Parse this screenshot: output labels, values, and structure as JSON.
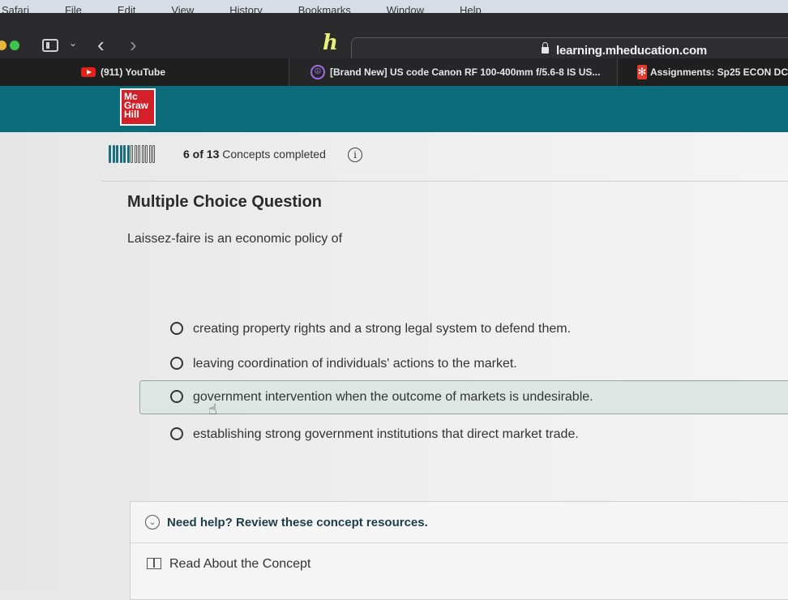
{
  "menubar": {
    "items": [
      "Safari",
      "File",
      "Edit",
      "View",
      "History",
      "Bookmarks",
      "Window",
      "Help"
    ]
  },
  "browser": {
    "url": "learning.mheducation.com",
    "tabs": [
      {
        "label": "(911) YouTube",
        "icon": "youtube-icon"
      },
      {
        "label": "[Brand New] US code Canon RF 100-400mm f/5.6-8 IS US...",
        "icon": "peace-icon"
      },
      {
        "label": "Assignments: Sp25 ECON DC",
        "icon": "canvas-icon"
      }
    ]
  },
  "brand": {
    "logo_lines": [
      "Mc",
      "Graw",
      "Hill"
    ],
    "accent": "#0b6b7b",
    "logo_color": "#d5202a"
  },
  "progress": {
    "completed": 6,
    "total": 13,
    "count_text": "6 of 13",
    "suffix": "Concepts completed"
  },
  "question": {
    "heading": "Multiple Choice Question",
    "text": "Laissez-faire is an economic policy of",
    "options": [
      "creating property rights and a strong legal system to defend them.",
      "leaving coordination of individuals' actions to the market.",
      "government intervention when the outcome of markets is undesirable.",
      "establishing strong government institutions that direct market trade."
    ]
  },
  "help": {
    "toggle_label": "Need help? Review these concept resources.",
    "read_label": "Read About the Concept"
  }
}
